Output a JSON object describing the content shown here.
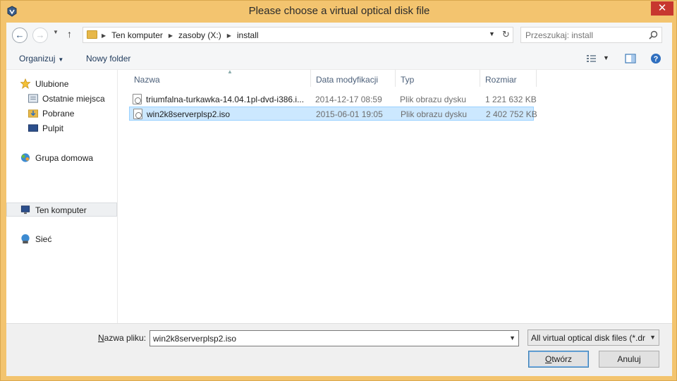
{
  "window": {
    "title": "Please choose a virtual optical disk file",
    "close_label": "✕"
  },
  "address": {
    "crumbs": [
      "Ten komputer",
      "zasoby (X:)",
      "install"
    ],
    "search_placeholder": "Przeszukaj: install"
  },
  "toolbar": {
    "organize_label": "Organizuj",
    "new_folder_label": "Nowy folder"
  },
  "sidebar": {
    "items": [
      {
        "label": "Ulubione",
        "icon": "star-icon"
      },
      {
        "label": "Ostatnie miejsca",
        "icon": "recent-places-icon"
      },
      {
        "label": "Pobrane",
        "icon": "downloads-icon"
      },
      {
        "label": "Pulpit",
        "icon": "desktop-icon"
      },
      {
        "label": "Grupa domowa",
        "icon": "homegroup-icon"
      },
      {
        "label": "Ten komputer",
        "icon": "computer-icon",
        "selected": true
      },
      {
        "label": "Sieć",
        "icon": "network-icon"
      }
    ]
  },
  "columns": {
    "name": "Nazwa",
    "date": "Data modyfikacji",
    "type": "Typ",
    "size": "Rozmiar"
  },
  "files": [
    {
      "name": "triumfalna-turkawka-14.04.1pl-dvd-i386.i...",
      "date": "2014-12-17 08:59",
      "type": "Plik obrazu dysku",
      "size": "1 221 632 KB",
      "selected": false
    },
    {
      "name": "win2k8serverplsp2.iso",
      "date": "2015-06-01 19:05",
      "type": "Plik obrazu dysku",
      "size": "2 402 752 KB",
      "selected": true
    }
  ],
  "bottom": {
    "filename_label_prefix": "N",
    "filename_label_rest": "azwa pliku:",
    "filename_value": "win2k8serverplsp2.iso",
    "filetype_value": "All virtual optical disk files (*.dr",
    "open_prefix": "O",
    "open_rest": "twórz",
    "cancel_label": "Anuluj"
  },
  "colors": {
    "title_bar": "#f3c46f",
    "selection": "#cce8ff",
    "close": "#c7372f"
  }
}
